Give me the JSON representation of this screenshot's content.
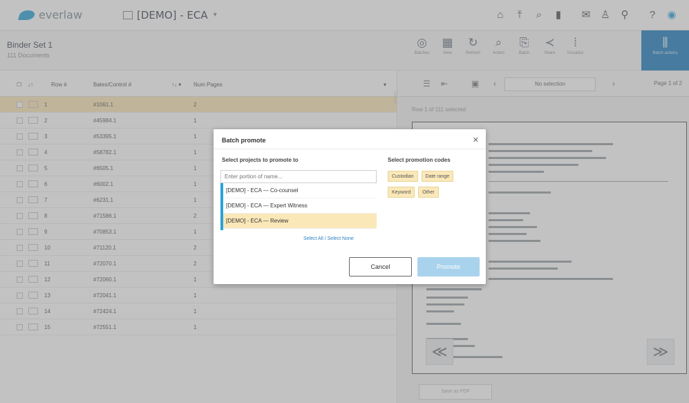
{
  "app": {
    "logo_text": "everlaw",
    "project_name": "[DEMO] - ECA",
    "project_caret": "▾"
  },
  "top_icons": [
    {
      "name": "home-icon",
      "glyph": "⌂"
    },
    {
      "name": "upload-icon",
      "glyph": "⤒"
    },
    {
      "name": "search-icon",
      "glyph": "⌕"
    },
    {
      "name": "analytics-icon",
      "glyph": "▮"
    },
    {
      "name": "messages-icon",
      "glyph": "✉"
    },
    {
      "name": "people-icon",
      "glyph": "♙"
    },
    {
      "name": "location-icon",
      "glyph": "⚲"
    },
    {
      "name": "help-icon",
      "glyph": "?"
    },
    {
      "name": "user-icon",
      "glyph": "◉"
    }
  ],
  "binder": {
    "title": "Binder Set 1",
    "count": "111 Documents"
  },
  "tools": [
    {
      "name": "tool-batches",
      "glyph": "◎",
      "label": "Batches"
    },
    {
      "name": "tool-view",
      "glyph": "▦",
      "label": "View"
    },
    {
      "name": "tool-refresh",
      "glyph": "↻",
      "label": "Refresh"
    },
    {
      "name": "tool-search",
      "glyph": "⌕",
      "label": "Action"
    },
    {
      "name": "tool-export",
      "glyph": "⎘",
      "label": "Batch"
    },
    {
      "name": "tool-share",
      "glyph": "≺",
      "label": "Share"
    },
    {
      "name": "tool-visualize",
      "glyph": "⦙",
      "label": "Visualize"
    }
  ],
  "active_tool": {
    "glyph": "⫼",
    "label": "Batch actions"
  },
  "table": {
    "headers": {
      "row": "Row #",
      "bates": "Bates/Control #",
      "sort": "↑↓ ▾",
      "pages": "Num Pages"
    },
    "rows": [
      {
        "num": "1",
        "bates": "#1061.1",
        "pages": "2"
      },
      {
        "num": "2",
        "bates": "#45984.1",
        "pages": "1"
      },
      {
        "num": "3",
        "bates": "#53395.1",
        "pages": "1"
      },
      {
        "num": "4",
        "bates": "#58782.1",
        "pages": "1"
      },
      {
        "num": "5",
        "bates": "#6505.1",
        "pages": "1"
      },
      {
        "num": "6",
        "bates": "#6002.1",
        "pages": "1"
      },
      {
        "num": "7",
        "bates": "#6231.1",
        "pages": "1"
      },
      {
        "num": "8",
        "bates": "#71586.1",
        "pages": "2"
      },
      {
        "num": "9",
        "bates": "#70853.1",
        "pages": "1"
      },
      {
        "num": "10",
        "bates": "#71120.1",
        "pages": "2"
      },
      {
        "num": "11",
        "bates": "#72070.1",
        "pages": "2"
      },
      {
        "num": "12",
        "bates": "#72060.1",
        "pages": "1"
      },
      {
        "num": "13",
        "bates": "#72041.1",
        "pages": "1"
      },
      {
        "num": "14",
        "bates": "#72424.1",
        "pages": "1"
      },
      {
        "num": "15",
        "bates": "#72551.1",
        "pages": "1"
      }
    ]
  },
  "viewer": {
    "select_label": "No selection",
    "page_label": "Page 1 of 2",
    "sub_label": "Row 1 of 111 selected",
    "prev": "≪",
    "next": "≫",
    "footer": "Save as PDF"
  },
  "modal": {
    "title": "Batch promote",
    "close": "✕",
    "projects_heading": "Select projects to promote to",
    "codes_heading": "Select promotion codes",
    "input_placeholder": "Enter portion of name...",
    "projects": [
      "[DEMO] - ECA — Co-counsel",
      "[DEMO] - ECA — Expert Witness",
      "[DEMO] - ECA — Review"
    ],
    "select_all": "Select All / Select None",
    "codes": [
      "Custodian",
      "Date range",
      "Keyword",
      "Other"
    ],
    "cancel": "Cancel",
    "promote": "Promote"
  }
}
